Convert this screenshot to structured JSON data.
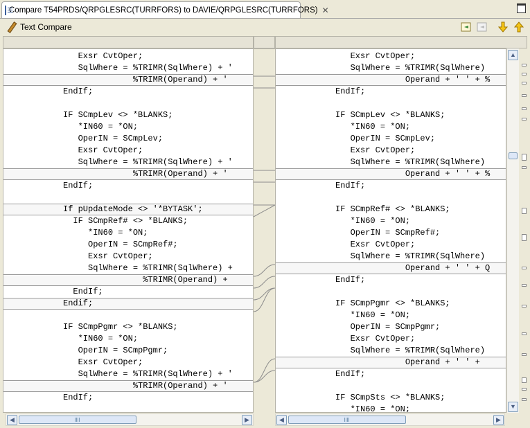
{
  "tab": {
    "title": "Compare T54PRDS/QRPGLESRC(TURRFORS) to DAVIE/QRPGLESRC(TURRFORS)",
    "close": "✕"
  },
  "toolbar": {
    "title": "Text Compare"
  },
  "left": [
    "        Exsr CvtOper;",
    "        SqlWhere = %TRIMR(SqlWhere) + '",
    "                   %TRIMR(Operand) + '",
    "     EndIf;",
    "",
    "     IF SCmpLev <> *BLANKS;",
    "        *IN60 = *ON;",
    "        OperIN = SCmpLev;",
    "        Exsr CvtOper;",
    "        SqlWhere = %TRIMR(SqlWhere) + '",
    "                   %TRIMR(Operand) + '",
    "     EndIf;",
    "",
    "     If pUpdateMode <> '*BYTASK';",
    "       IF SCmpRef# <> *BLANKS;",
    "          *IN60 = *ON;",
    "          OperIN = SCmpRef#;",
    "          Exsr CvtOper;",
    "          SqlWhere = %TRIMR(SqlWhere) +",
    "                     %TRIMR(Operand) +",
    "       EndIf;",
    "     Endif;",
    "",
    "     IF SCmpPgmr <> *BLANKS;",
    "        *IN60 = *ON;",
    "        OperIN = SCmpPgmr;",
    "        Exsr CvtOper;",
    "        SqlWhere = %TRIMR(SqlWhere) + '",
    "                   %TRIMR(Operand) + '",
    "     EndIf;"
  ],
  "right": [
    "        Exsr CvtOper;",
    "        SqlWhere = %TRIMR(SqlWhere)",
    "                   Operand + ' ' + %",
    "     EndIf;",
    "",
    "     IF SCmpLev <> *BLANKS;",
    "        *IN60 = *ON;",
    "        OperIN = SCmpLev;",
    "        Exsr CvtOper;",
    "        SqlWhere = %TRIMR(SqlWhere)",
    "                   Operand + ' ' + %",
    "     EndIf;",
    "",
    "     IF SCmpRef# <> *BLANKS;",
    "        *IN60 = *ON;",
    "        OperIN = SCmpRef#;",
    "        Exsr CvtOper;",
    "        SqlWhere = %TRIMR(SqlWhere)",
    "                   Operand + ' ' + Q",
    "     EndIf;",
    "",
    "     IF SCmpPgmr <> *BLANKS;",
    "        *IN60 = *ON;",
    "        OperIN = SCmpPgmr;",
    "        Exsr CvtOper;",
    "        SqlWhere = %TRIMR(SqlWhere)",
    "                   Operand + ' ' +",
    "     EndIf;",
    "",
    "     IF SCmpSts <> *BLANKS;",
    "        *IN60 = *ON;"
  ]
}
